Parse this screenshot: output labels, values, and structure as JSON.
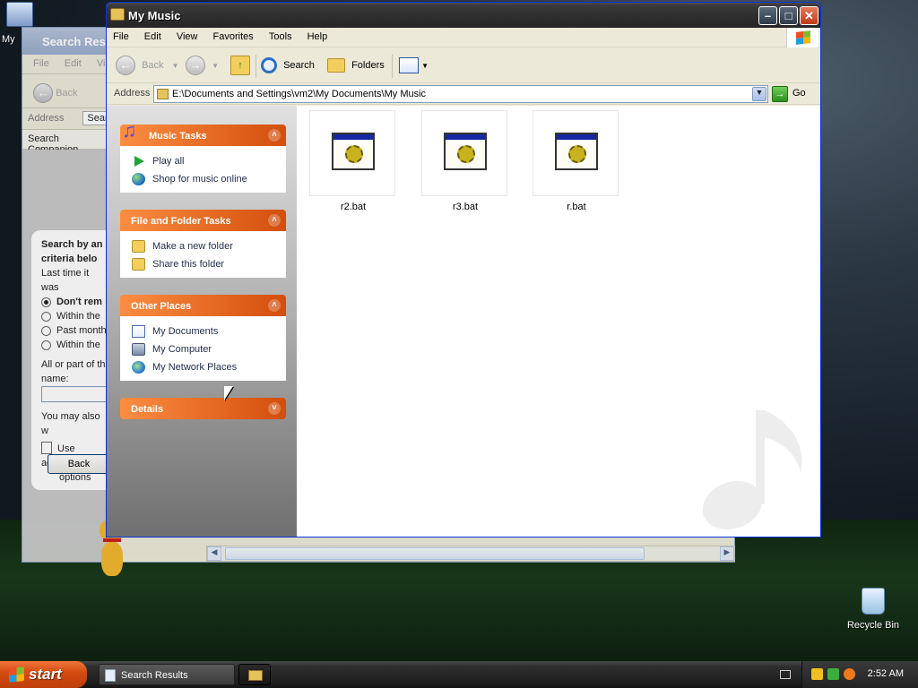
{
  "desktop": {
    "icon_my_computer_label": "My",
    "icon_recycle_bin_label": "Recycle Bin"
  },
  "search_window": {
    "title": "Search Results",
    "menu": [
      "File",
      "Edit",
      "Vie"
    ],
    "back_label": "Back",
    "address_label": "Address",
    "address_value": "Sear",
    "companion_label": "Search Companion",
    "heading": "Search by any or all of the criteria below",
    "heading_line1": "Search by an",
    "heading_line2": "criteria belo",
    "last_time_label": "Last time it was",
    "options": [
      "Don't rem",
      "Within the",
      "Past month",
      "Within the"
    ],
    "name_label": "All or part of the file name:",
    "name_label_l1": "All or part of th",
    "name_label_l2": "name:",
    "you_may_also": "You may also w",
    "use_advanced_l1": "Use advanc",
    "use_advanced_l2": "options",
    "back_button": "Back"
  },
  "window": {
    "title": "My Music",
    "menu": [
      "File",
      "Edit",
      "View",
      "Favorites",
      "Tools",
      "Help"
    ],
    "toolbar": {
      "back": "Back",
      "search": "Search",
      "folders": "Folders"
    },
    "address_label": "Address",
    "address_value": "E:\\Documents and Settings\\vm2\\My Documents\\My Music",
    "go_label": "Go"
  },
  "tasks": {
    "music_tasks": {
      "title": "Music Tasks",
      "items": [
        "Play all",
        "Shop for music online"
      ]
    },
    "file_folder_tasks": {
      "title": "File and Folder Tasks",
      "items": [
        "Make a new folder",
        "Share this folder"
      ]
    },
    "other_places": {
      "title": "Other Places",
      "items": [
        "My Documents",
        "My Computer",
        "My Network Places"
      ]
    },
    "details": {
      "title": "Details"
    }
  },
  "files": [
    {
      "name": "r2.bat",
      "icon": "batch-file-icon"
    },
    {
      "name": "r3.bat",
      "icon": "batch-file-icon"
    },
    {
      "name": "r.bat",
      "icon": "batch-file-icon"
    }
  ],
  "taskbar": {
    "start_label": "start",
    "buttons": [
      "Search Results"
    ],
    "clock": "2:52 AM"
  }
}
